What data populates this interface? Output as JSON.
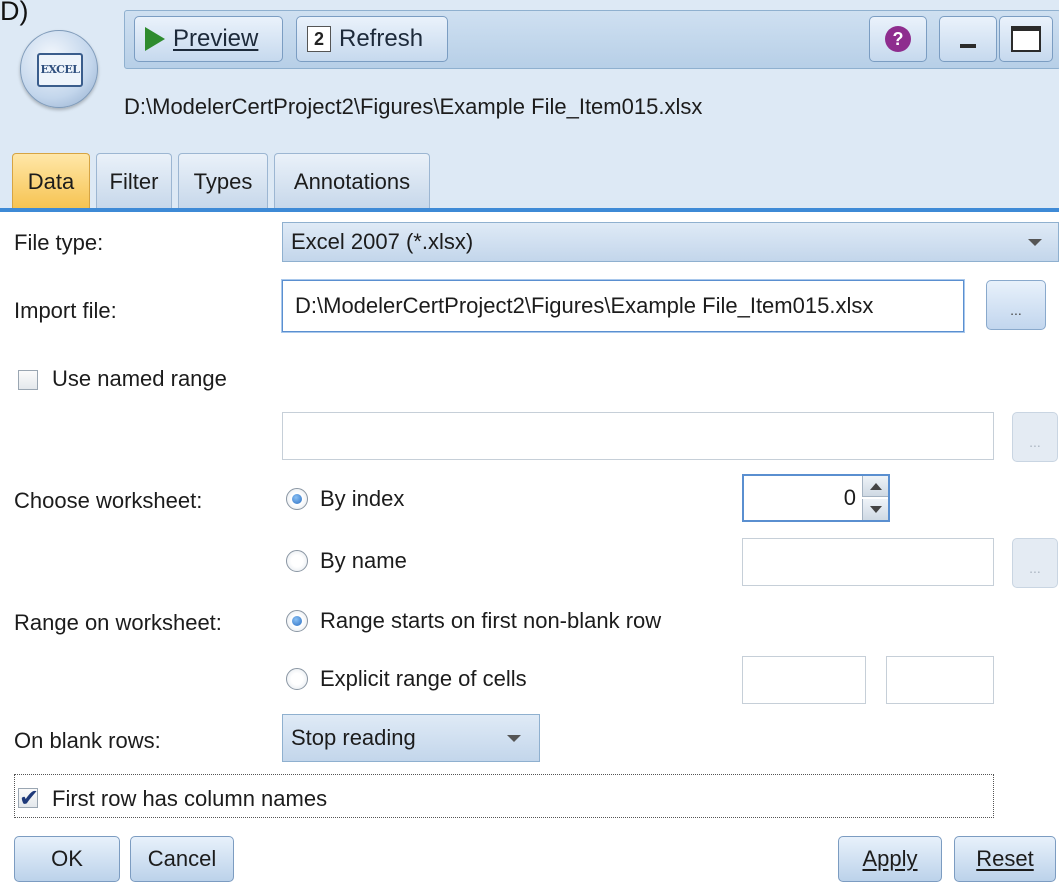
{
  "corner_label": "D)",
  "toolbar": {
    "preview_label": "Preview",
    "refresh_label": "Refresh",
    "help_glyph": "?"
  },
  "node": {
    "badge": "EXCEL"
  },
  "file_path": "D:\\ModelerCertProject2\\Figures\\Example File_Item015.xlsx",
  "tabs": [
    {
      "label": "Data",
      "active": true
    },
    {
      "label": "Filter"
    },
    {
      "label": "Types"
    },
    {
      "label": "Annotations"
    }
  ],
  "form": {
    "file_type_label": "File type:",
    "file_type_value": "Excel 2007 (*.xlsx)",
    "import_file_label": "Import file:",
    "import_file_value": "D:\\ModelerCertProject2\\Figures\\Example File_Item015.xlsx",
    "browse_label": "...",
    "use_named_range_label": "Use named range",
    "use_named_range_checked": false,
    "named_range_value": "",
    "choose_worksheet_label": "Choose worksheet:",
    "by_index_label": "By index",
    "by_index_value": "0",
    "by_name_label": "By name",
    "range_on_worksheet_label": "Range on worksheet:",
    "range_first_nonblank_label": "Range starts on first non-blank row",
    "explicit_range_label": "Explicit range of cells",
    "on_blank_rows_label": "On blank rows:",
    "on_blank_rows_value": "Stop reading",
    "first_row_names_label": "First row has column names",
    "first_row_names_checked": true
  },
  "footer": {
    "ok_label": "OK",
    "cancel_label": "Cancel",
    "apply_label": "Apply",
    "reset_label": "Reset"
  },
  "colors": {
    "header_bg": "#dde9f5",
    "active_tab": "#f6c24f",
    "tab_rule": "#3e8ad6",
    "radio_selected": "#2a6fc3"
  }
}
